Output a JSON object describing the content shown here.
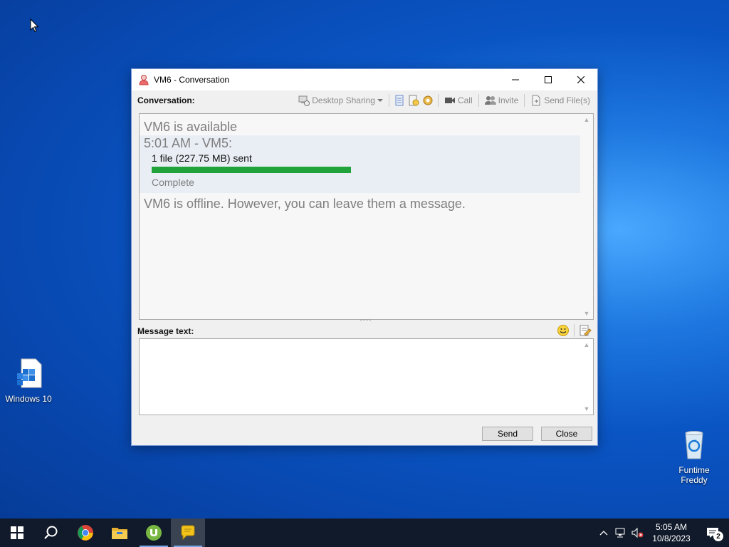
{
  "desktop": {
    "icons": [
      {
        "label": "Windows 10"
      },
      {
        "label": "Funtime Freddy"
      }
    ]
  },
  "window": {
    "title": "VM6 - Conversation",
    "conversation_label": "Conversation:",
    "toolbar": {
      "desktop_sharing": "Desktop Sharing",
      "call": "Call",
      "invite": "Invite",
      "send_files": "Send File(s)"
    },
    "conversation": {
      "available_status": "VM6 is available",
      "message_header": "5:01 AM - VM5:",
      "file_info": "1 file (227.75 MB) sent",
      "progress": 1.0,
      "progress_color": "#1fa33a",
      "complete_status": "Complete",
      "offline_status": "VM6 is offline. However, you can leave them a message."
    },
    "message_text_label": "Message text:",
    "message_value": "",
    "send_button": "Send",
    "close_button": "Close"
  },
  "taskbar": {
    "apps": [
      "start-icon",
      "search-icon",
      "chrome-icon",
      "file-explorer-icon",
      "utorrent-icon",
      "messenger-icon"
    ],
    "clock_time": "5:05 AM",
    "clock_date": "10/8/2023",
    "notification_count": "2"
  }
}
